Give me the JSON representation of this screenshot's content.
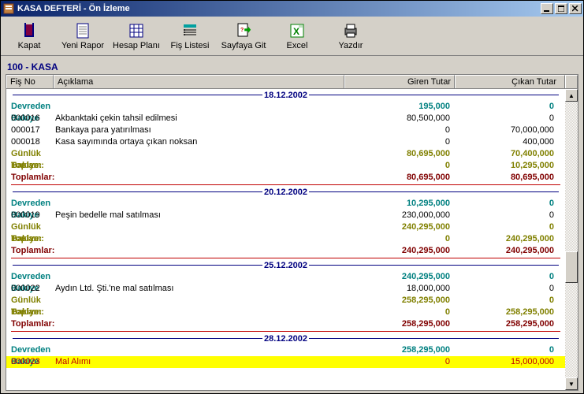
{
  "window": {
    "title": "KASA DEFTERİ - Ön İzleme"
  },
  "toolbar": {
    "close": "Kapat",
    "newReport": "Yeni Rapor",
    "chartPlan": "Hesap Planı",
    "receiptList": "Fiş Listesi",
    "gotoPage": "Sayfaya Git",
    "excel": "Excel",
    "print": "Yazdır"
  },
  "accountTitle": "100 - KASA",
  "columns": {
    "fisNo": "Fiş No",
    "desc": "Açıklama",
    "in": "Giren Tutar",
    "out": "Çıkan Tutar"
  },
  "labels": {
    "devreden": "Devreden Bakiye",
    "gunluk": "Günlük Toplam:",
    "bakiye": "Bakiye:",
    "toplamlar": "Toplamlar:"
  },
  "groups": [
    {
      "date": "18.12.2002",
      "devreden": {
        "in": "195,000",
        "out": "0"
      },
      "rows": [
        {
          "fis": "000016",
          "desc": "Akbanktaki  çekin tahsil edilmesi",
          "in": "80,500,000",
          "out": "0"
        },
        {
          "fis": "000017",
          "desc": "Bankaya para yatırılması",
          "in": "0",
          "out": "70,000,000"
        },
        {
          "fis": "000018",
          "desc": "Kasa sayımında ortaya çıkan noksan",
          "in": "0",
          "out": "400,000"
        }
      ],
      "gunluk": {
        "in": "80,695,000",
        "out": "70,400,000"
      },
      "bakiye": {
        "in": "0",
        "out": "10,295,000"
      },
      "toplamlar": {
        "in": "80,695,000",
        "out": "80,695,000"
      }
    },
    {
      "date": "20.12.2002",
      "devreden": {
        "in": "10,295,000",
        "out": "0"
      },
      "rows": [
        {
          "fis": "000019",
          "desc": "Peşin bedelle mal satılması",
          "in": "230,000,000",
          "out": "0"
        }
      ],
      "gunluk": {
        "in": "240,295,000",
        "out": "0"
      },
      "bakiye": {
        "in": "0",
        "out": "240,295,000"
      },
      "toplamlar": {
        "in": "240,295,000",
        "out": "240,295,000"
      }
    },
    {
      "date": "25.12.2002",
      "devreden": {
        "in": "240,295,000",
        "out": "0"
      },
      "rows": [
        {
          "fis": "000022",
          "desc": "Aydın Ltd. Şti.'ne mal satılması",
          "in": "18,000,000",
          "out": "0"
        }
      ],
      "gunluk": {
        "in": "258,295,000",
        "out": "0"
      },
      "bakiye": {
        "in": "0",
        "out": "258,295,000"
      },
      "toplamlar": {
        "in": "258,295,000",
        "out": "258,295,000"
      }
    },
    {
      "date": "28.12.2002",
      "devreden": {
        "in": "258,295,000",
        "out": "0"
      },
      "rows": [
        {
          "fis": "000023",
          "desc": "Mal Alımı",
          "in": "0",
          "out": "15,000,000",
          "highlight": true
        }
      ]
    }
  ]
}
